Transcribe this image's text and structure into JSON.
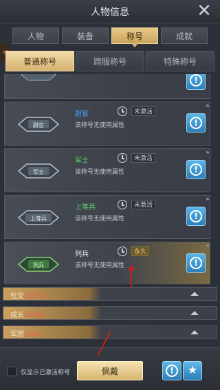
{
  "header": {
    "title": "人物信息"
  },
  "tabs": [
    {
      "label": "人物"
    },
    {
      "label": "装备"
    },
    {
      "label": "称号"
    },
    {
      "label": "成就"
    }
  ],
  "subtabs": [
    {
      "label": "普通称号"
    },
    {
      "label": "跨服称号"
    },
    {
      "label": "特殊称号"
    }
  ],
  "titles": [
    {
      "name": "尉官",
      "badge": "尉官",
      "status": "未激活",
      "desc": "该称号无使用属性",
      "name_color": "#4aa3ff"
    },
    {
      "name": "军士",
      "badge": "军士",
      "status": "未激活",
      "desc": "该称号无使用属性",
      "name_color": "#62d46a"
    },
    {
      "name": "上等兵",
      "badge": "上等兵",
      "status": "未激活",
      "desc": "该称号无使用属性",
      "name_color": "#62d46a"
    },
    {
      "name": "列兵",
      "badge": "列兵",
      "status": "永久",
      "desc": "该称号无使用属性",
      "name_color": "#e8ecf0"
    }
  ],
  "sections": [
    {
      "label": "社交",
      "count": "(0/23)"
    },
    {
      "label": "成长",
      "count": "(0/14)"
    },
    {
      "label": "军团",
      "count": "(0/8)"
    }
  ],
  "bottom": {
    "checkbox_label": "仅显示已激活称号",
    "equip_label": "佩戴"
  }
}
